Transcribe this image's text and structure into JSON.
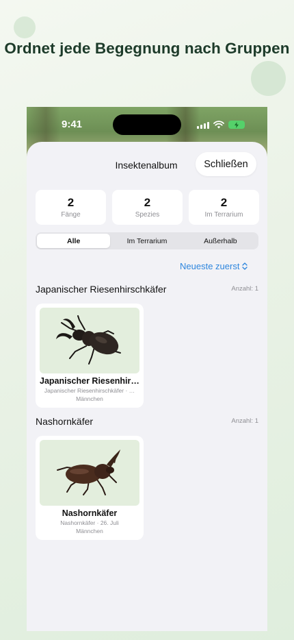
{
  "headline": "Ordnet jede Begegnung nach Gruppen",
  "status_bar": {
    "time": "9:41"
  },
  "sheet": {
    "title": "Insektenalbum",
    "close_label": "Schließen"
  },
  "stats": [
    {
      "value": "2",
      "label": "Fänge"
    },
    {
      "value": "2",
      "label": "Spezies"
    },
    {
      "value": "2",
      "label": "Im Terrarium"
    }
  ],
  "filters": {
    "options": [
      "Alle",
      "Im Terrarium",
      "Außerhalb"
    ],
    "selected": "Alle"
  },
  "sort": {
    "label": "Neueste zuerst"
  },
  "groups": [
    {
      "title": "Japanischer Riesenhirschkäfer",
      "count": "Anzahl: 1",
      "card": {
        "name": "Japanischer Riesenhirs…",
        "meta_line1": "Japanischer Riesenhirschkäfer · …",
        "meta_line2": "Männchen",
        "icon": "stag-beetle-icon"
      }
    },
    {
      "title": "Nashornkäfer",
      "count": "Anzahl: 1",
      "card": {
        "name": "Nashornkäfer",
        "meta_line1": "Nashornkäfer · 26. Juli",
        "meta_line2": "Männchen",
        "icon": "rhinoceros-beetle-icon"
      }
    }
  ],
  "colors": {
    "accent": "#2e86de",
    "headline": "#1d3b2a",
    "sheet_bg": "#f2f2f6",
    "thumb_bg": "#e3eedd"
  }
}
